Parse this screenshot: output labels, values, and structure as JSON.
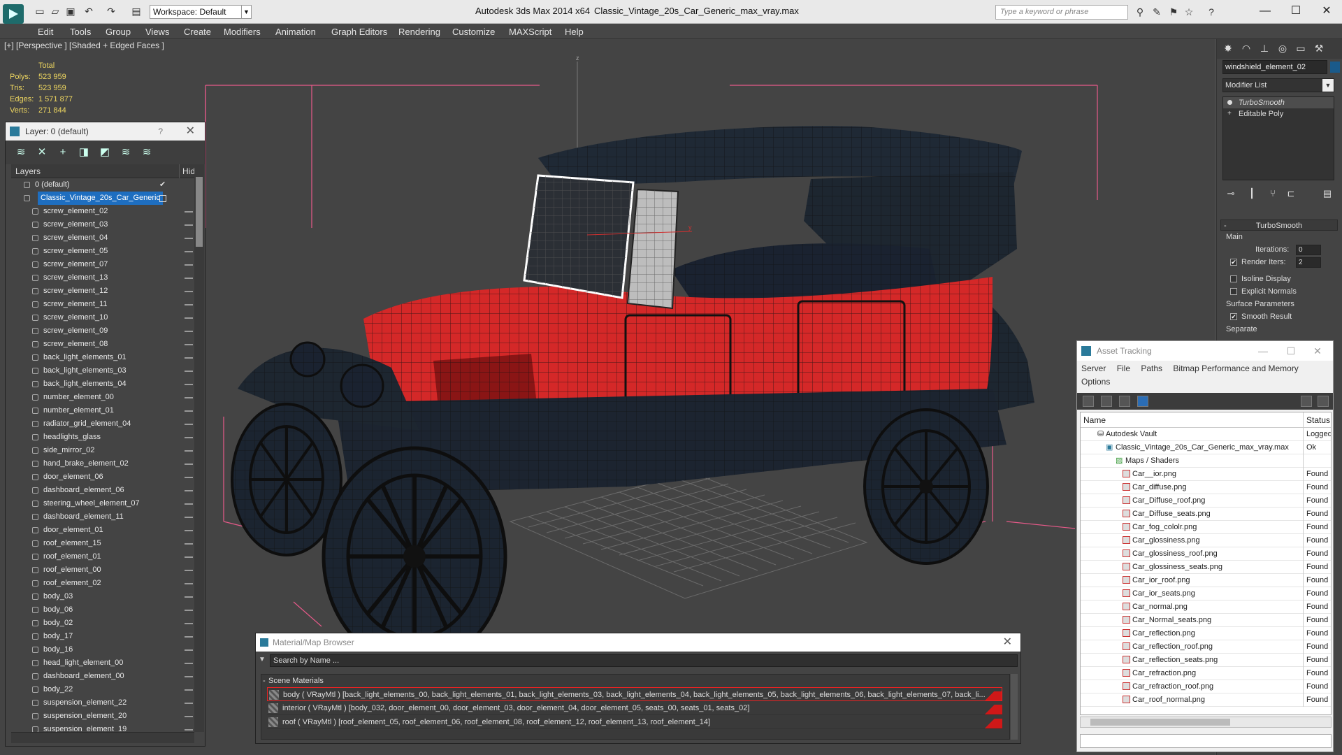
{
  "titlebar": {
    "workspace": "Workspace: Default",
    "app_title": "Autodesk 3ds Max  2014 x64",
    "file_title": "Classic_Vintage_20s_Car_Generic_max_vray.max",
    "search_placeholder": "Type a keyword or phrase"
  },
  "menu": [
    "Edit",
    "Tools",
    "Group",
    "Views",
    "Create",
    "Modifiers",
    "Animation",
    "Graph Editors",
    "Rendering",
    "Customize",
    "MAXScript",
    "Help"
  ],
  "viewport": {
    "label": "[+] [Perspective ] [Shaded + Edged Faces ]",
    "axis_z": "z",
    "axis_y": "y",
    "stats": {
      "total_label": "Total",
      "polys_label": "Polys:",
      "polys": "523 959",
      "tris_label": "Tris:",
      "tris": "523 959",
      "edges_label": "Edges:",
      "edges": "1 571 877",
      "verts_label": "Verts:",
      "verts": "271 844"
    }
  },
  "layer_panel": {
    "title": "Layer: 0 (default)",
    "help": "?",
    "col_layers": "Layers",
    "col_hide": "Hide",
    "default_layer": "0 (default)",
    "selected_layer": "Classic_Vintage_20s_Car_Generic",
    "items": [
      "screw_element_02",
      "screw_element_03",
      "screw_element_04",
      "screw_element_05",
      "screw_element_07",
      "screw_element_13",
      "screw_element_12",
      "screw_element_11",
      "screw_element_10",
      "screw_element_09",
      "screw_element_08",
      "back_light_elements_01",
      "back_light_elements_03",
      "back_light_elements_04",
      "number_element_00",
      "number_element_01",
      "radiator_grid_element_04",
      "headlights_glass",
      "side_mirror_02",
      "hand_brake_element_02",
      "door_element_06",
      "dashboard_element_06",
      "steering_wheel_element_07",
      "dashboard_element_11",
      "door_element_01",
      "roof_element_15",
      "roof_element_01",
      "roof_element_00",
      "roof_element_02",
      "body_03",
      "body_06",
      "body_02",
      "body_17",
      "body_16",
      "head_light_element_00",
      "dashboard_element_00",
      "body_22",
      "suspension_element_22",
      "suspension_element_20",
      "suspension_element_19"
    ]
  },
  "command_panel": {
    "object_name": "windshield_element_02",
    "modifier_list": "Modifier List",
    "stack": [
      "TurboSmooth",
      "Editable Poly"
    ],
    "rollout_title": "TurboSmooth",
    "main_group": "Main",
    "iterations_label": "Iterations:",
    "iterations": "0",
    "render_iters_label": "Render Iters:",
    "render_iters": "2",
    "isoline": "Isoline Display",
    "explicit": "Explicit Normals",
    "surface_group": "Surface Parameters",
    "smooth_result": "Smooth Result",
    "separate": "Separate"
  },
  "asset_tracking": {
    "title": "Asset Tracking",
    "menu": [
      "Server",
      "File",
      "Paths",
      "Bitmap Performance and Memory",
      "Options"
    ],
    "col_name": "Name",
    "col_status": "Status",
    "vault": {
      "name": "Autodesk Vault",
      "status": "Logged"
    },
    "file": {
      "name": "Classic_Vintage_20s_Car_Generic_max_vray.max",
      "status": "Ok"
    },
    "maps_folder": "Maps / Shaders",
    "maps": [
      {
        "name": "Car__ior.png",
        "status": "Found"
      },
      {
        "name": "Car_diffuse.png",
        "status": "Found"
      },
      {
        "name": "Car_Diffuse_roof.png",
        "status": "Found"
      },
      {
        "name": "Car_Diffuse_seats.png",
        "status": "Found"
      },
      {
        "name": "Car_fog_cololr.png",
        "status": "Found"
      },
      {
        "name": "Car_glossiness.png",
        "status": "Found"
      },
      {
        "name": "Car_glossiness_roof.png",
        "status": "Found"
      },
      {
        "name": "Car_glossiness_seats.png",
        "status": "Found"
      },
      {
        "name": "Car_ior_roof.png",
        "status": "Found"
      },
      {
        "name": "Car_ior_seats.png",
        "status": "Found"
      },
      {
        "name": "Car_normal.png",
        "status": "Found"
      },
      {
        "name": "Car_Normal_seats.png",
        "status": "Found"
      },
      {
        "name": "Car_reflection.png",
        "status": "Found"
      },
      {
        "name": "Car_reflection_roof.png",
        "status": "Found"
      },
      {
        "name": "Car_reflection_seats.png",
        "status": "Found"
      },
      {
        "name": "Car_refraction.png",
        "status": "Found"
      },
      {
        "name": "Car_refraction_roof.png",
        "status": "Found"
      },
      {
        "name": "Car_roof_normal.png",
        "status": "Found"
      }
    ]
  },
  "material_browser": {
    "title": "Material/Map Browser",
    "search_placeholder": "Search by Name ...",
    "section": "Scene Materials",
    "materials": [
      "body  ( VRayMtl ) [back_light_elements_00, back_light_elements_01, back_light_elements_03, back_light_elements_04, back_light_elements_05, back_light_elements_06, back_light_elements_07, back_li...",
      "interior  ( VRayMtl ) [body_032, door_element_00, door_element_03, door_element_04, door_element_05, seats_00, seats_01, seats_02]",
      "roof  ( VRayMtl ) [roof_element_05, roof_element_06, roof_element_08, roof_element_12, roof_element_13, roof_element_14]"
    ]
  },
  "colors": {
    "car_body": "#d42828",
    "wire": "#1a1a1a",
    "selection": "#1e6ec0",
    "stats": "#f0d860"
  }
}
